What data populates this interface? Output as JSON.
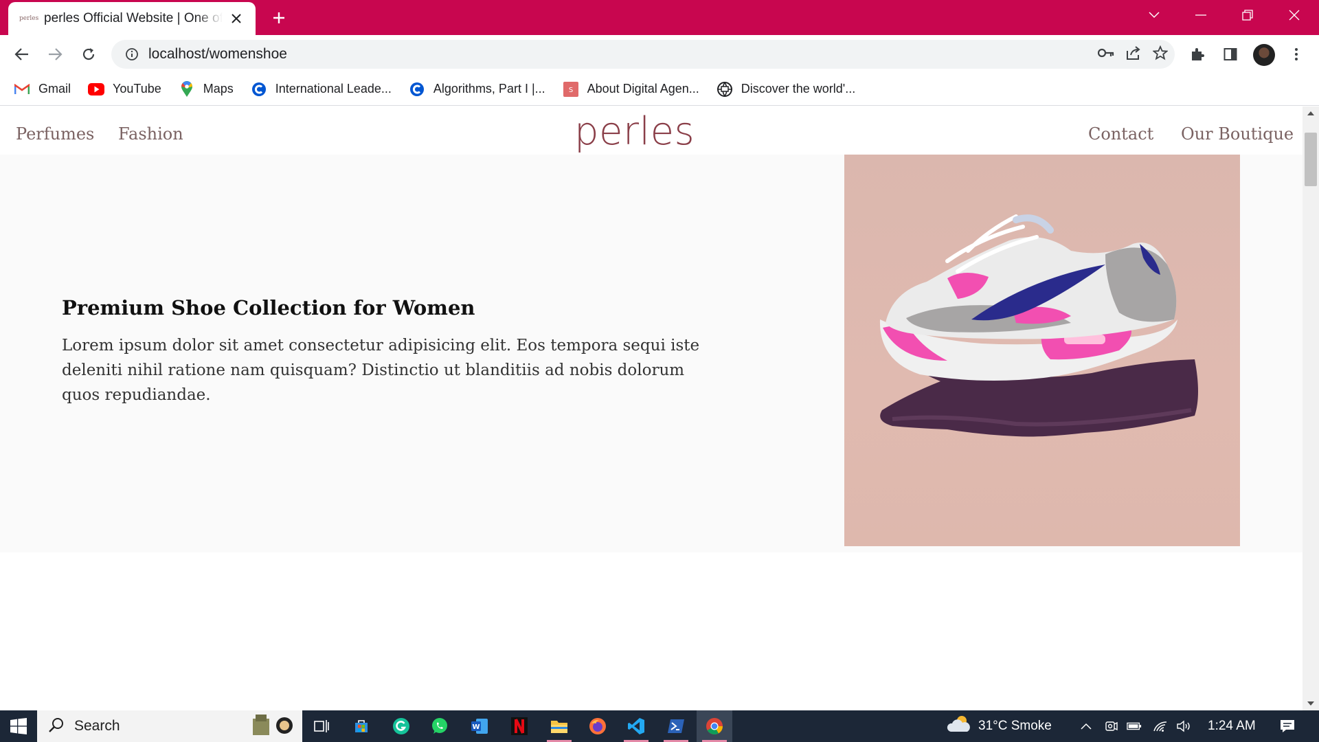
{
  "browser": {
    "tab": {
      "favicon_text": "perles",
      "title": "perles Official Website | One of a Kind"
    },
    "url": "localhost/womenshoe",
    "bookmarks": [
      {
        "label": "Gmail",
        "icon": "gmail-icon"
      },
      {
        "label": "YouTube",
        "icon": "youtube-icon"
      },
      {
        "label": "Maps",
        "icon": "maps-icon"
      },
      {
        "label": "International Leade...",
        "icon": "coursera-icon"
      },
      {
        "label": "Algorithms, Part I |...",
        "icon": "coursera-icon"
      },
      {
        "label": "About Digital Agen...",
        "icon": "s-site-icon"
      },
      {
        "label": "Discover the world'...",
        "icon": "globe-site-icon"
      }
    ],
    "colors": {
      "tabbar": "#c8064f"
    }
  },
  "site": {
    "nav_left": [
      "Perfumes",
      "Fashion"
    ],
    "logo": "perles",
    "nav_right": [
      "Contact",
      "Our Boutique"
    ],
    "hero": {
      "title": "Premium Shoe Collection for Women",
      "body": "Lorem ipsum dolor sit amet consectetur adipisicing elit. Eos tempora sequi iste deleniti nihil ratione nam quisquam? Distinctio ut blanditiis ad nobis dolorum quos repudiandae.",
      "image": "sneaker-on-hand-image"
    },
    "colors": {
      "logo": "#8a3e48",
      "nav": "#7a6262",
      "hero_bg": "#fafafa",
      "image_bg": "#dbb7ae"
    }
  },
  "taskbar": {
    "search_label": "Search",
    "weather": "31°C  Smoke",
    "time": "1:24 AM",
    "apps": [
      "task-view",
      "microsoft-store",
      "grammarly",
      "whatsapp",
      "word",
      "netflix",
      "file-explorer",
      "firefox",
      "vscode",
      "powershell",
      "chrome"
    ]
  }
}
